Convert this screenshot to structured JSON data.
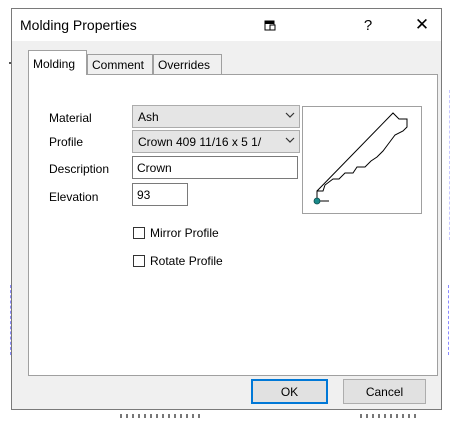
{
  "dialog": {
    "title": "Molding Properties",
    "title_buttons": {
      "restore_icon": "restore-window-icon",
      "help_label": "?",
      "close_label": "✕"
    }
  },
  "tabs": [
    {
      "label": "Molding",
      "active": true
    },
    {
      "label": "Comment",
      "active": false
    },
    {
      "label": "Overrides",
      "active": false
    }
  ],
  "form": {
    "material": {
      "label": "Material",
      "value": "Ash"
    },
    "profile": {
      "label": "Profile",
      "value": "Crown 409 11/16 x 5 1/"
    },
    "description": {
      "label": "Description",
      "value": "Crown"
    },
    "elevation": {
      "label": "Elevation",
      "value": "93"
    },
    "mirror_profile": {
      "label": "Mirror Profile",
      "checked": false
    },
    "rotate_profile": {
      "label": "Rotate Profile",
      "checked": false
    }
  },
  "preview": {
    "icon": "crown-molding-profile",
    "anchor_color": "#1a8a8a"
  },
  "buttons": {
    "ok": "OK",
    "cancel": "Cancel"
  },
  "colors": {
    "accent": "#0078d7",
    "dialog_bg": "#f0f0f0"
  }
}
